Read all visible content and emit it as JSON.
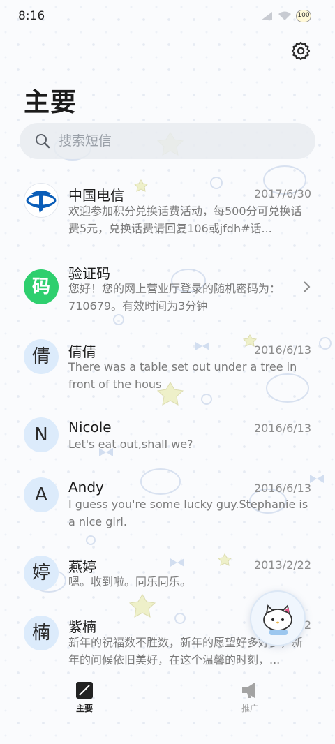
{
  "status_bar": {
    "time": "8:16",
    "battery": "100"
  },
  "header": {
    "title": "主要"
  },
  "search": {
    "placeholder": "搜索短信"
  },
  "conversations": [
    {
      "name": "中国电信",
      "date": "2017/6/30",
      "preview": "欢迎参加积分兑换话费活动，每500分可兑换话费5元，兑换话费请回复106或jfdh#话...",
      "avatar_icon": "china-telecom-logo-icon"
    },
    {
      "name": "验证码",
      "date": "",
      "preview": "您好！您的网上营业厅登录的随机密码为：710679。有效时间为3分钟",
      "avatar": "码"
    },
    {
      "name": "倩倩",
      "date": "2016/6/13",
      "preview": "There was a table set out under a tree in front of the hous",
      "avatar": "倩"
    },
    {
      "name": "Nicole",
      "date": "2016/6/13",
      "preview": "Let's eat out,shall we?",
      "avatar": "N"
    },
    {
      "name": "Andy",
      "date": "2016/6/13",
      "preview": "I guess you're some lucky guy.Stephanie is a nice girl.",
      "avatar": "A"
    },
    {
      "name": "燕婷",
      "date": "2013/2/22",
      "preview": "嗯。收到啦。同乐同乐。",
      "avatar": "婷"
    },
    {
      "name": "紫楠",
      "date": "2",
      "preview": "新年的祝福数不胜数，新年的愿望好多好多，新年的问候依旧美好，在这个温馨的时刻，...",
      "avatar": "楠"
    }
  ],
  "bottom_nav": {
    "main": "主要",
    "promo": "推广"
  },
  "colors": {
    "accent_green": "#2ecf6e",
    "avatar_bg": "#dcebfb",
    "telecom_blue": "#0a5db8"
  }
}
